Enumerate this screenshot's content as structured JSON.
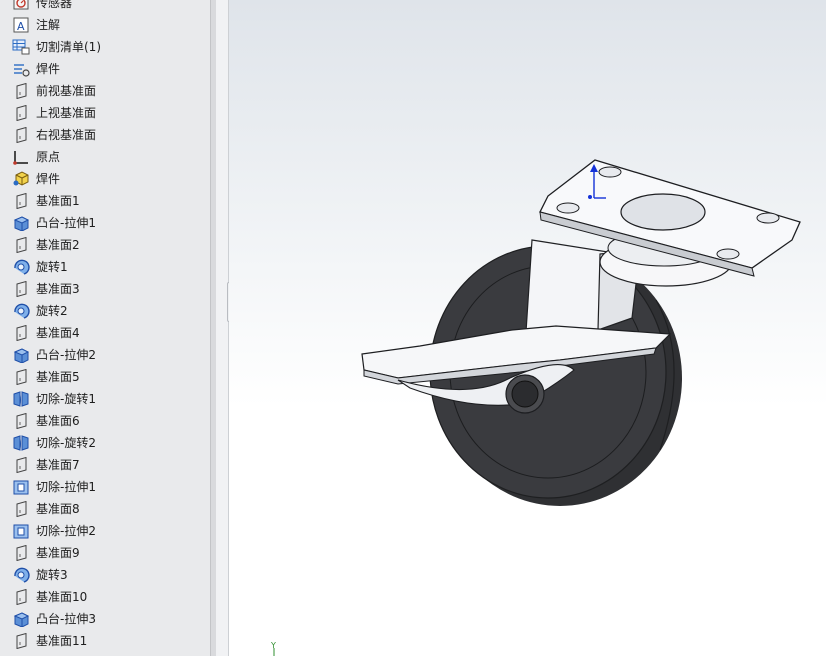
{
  "feature_tree": {
    "items": [
      {
        "label": "传感器",
        "icon": "sensor-icon"
      },
      {
        "label": "注解",
        "icon": "annotation-icon"
      },
      {
        "label": "切割清单(1)",
        "icon": "cut-list-icon"
      },
      {
        "label": "焊件",
        "icon": "weldment-settings-icon"
      },
      {
        "label": "前视基准面",
        "icon": "plane-icon"
      },
      {
        "label": "上视基准面",
        "icon": "plane-icon"
      },
      {
        "label": "右视基准面",
        "icon": "plane-icon"
      },
      {
        "label": "原点",
        "icon": "origin-icon"
      },
      {
        "label": "焊件",
        "icon": "weldment-icon"
      },
      {
        "label": "基准面1",
        "icon": "plane-icon"
      },
      {
        "label": "凸台-拉伸1",
        "icon": "extrude-boss-icon"
      },
      {
        "label": "基准面2",
        "icon": "plane-icon"
      },
      {
        "label": "旋转1",
        "icon": "revolve-icon"
      },
      {
        "label": "基准面3",
        "icon": "plane-icon"
      },
      {
        "label": "旋转2",
        "icon": "revolve-icon"
      },
      {
        "label": "基准面4",
        "icon": "plane-icon"
      },
      {
        "label": "凸台-拉伸2",
        "icon": "extrude-boss-icon"
      },
      {
        "label": "基准面5",
        "icon": "plane-icon"
      },
      {
        "label": "切除-旋转1",
        "icon": "cut-revolve-icon"
      },
      {
        "label": "基准面6",
        "icon": "plane-icon"
      },
      {
        "label": "切除-旋转2",
        "icon": "cut-revolve-icon"
      },
      {
        "label": "基准面7",
        "icon": "plane-icon"
      },
      {
        "label": "切除-拉伸1",
        "icon": "cut-extrude-icon"
      },
      {
        "label": "基准面8",
        "icon": "plane-icon"
      },
      {
        "label": "切除-拉伸2",
        "icon": "cut-extrude-icon"
      },
      {
        "label": "基准面9",
        "icon": "plane-icon"
      },
      {
        "label": "旋转3",
        "icon": "revolve-icon"
      },
      {
        "label": "基准面10",
        "icon": "plane-icon"
      },
      {
        "label": "凸台-拉伸3",
        "icon": "extrude-boss-icon"
      },
      {
        "label": "基准面11",
        "icon": "plane-icon"
      }
    ]
  },
  "viewport": {
    "model": "caster-wheel-model",
    "triad_label": "Y"
  },
  "colors": {
    "panel_bg": "#e9eaec",
    "icon_blue": "#2b6cc4",
    "wheel_dark": "#3a3b3f",
    "axis_blue": "#1432d8"
  }
}
